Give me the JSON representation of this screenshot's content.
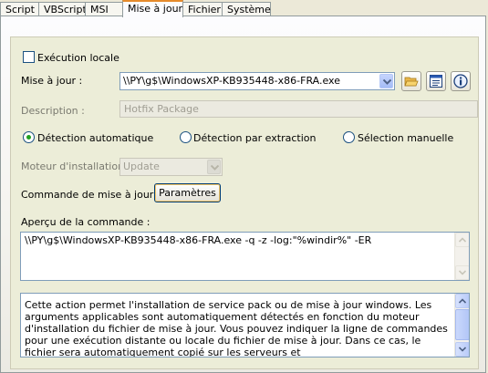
{
  "tabs": [
    "Script",
    "VBScript",
    "MSI",
    "Mise à jour",
    "Fichier",
    "Système"
  ],
  "active_tab": "Mise à jour",
  "form": {
    "local_exec_label": "Exécution locale",
    "update_label": "Mise à jour :",
    "update_value": "\\\\PY\\g$\\WindowsXP-KB935448-x86-FRA.exe",
    "description_label": "Description :",
    "description_value": "Hotfix Package",
    "radio_auto": "Détection automatique",
    "radio_extract": "Détection par extraction",
    "radio_manual": "Sélection manuelle",
    "engine_label": "Moteur d'installation :",
    "engine_value": "Update",
    "command_label": "Commande de mise à jour :",
    "params_button": "Paramètres",
    "preview_label": "Aperçu de la commande :",
    "preview_value": "\\\\PY\\g$\\WindowsXP-KB935448-x86-FRA.exe -q -z -log:\"%windir%\" -ER",
    "help_text": "Cette action permet l'installation de service pack ou de mise à jour windows. Les arguments applicables sont automatiquement détectés en fonction du moteur d'installation du fichier de mise à jour. Vous pouvez indiquer la ligne de commandes pour une exécution distante ou locale du fichier de mise à jour. Dans ce cas, le fichier sera automatiquement copié sur les serveurs et"
  },
  "state": {
    "local_exec_checked": false,
    "detection_mode": "auto"
  },
  "icons": [
    "folder-open-icon",
    "window-properties-icon",
    "info-icon",
    "chevron-down-icon",
    "scroll-up-icon",
    "scroll-down-icon"
  ]
}
